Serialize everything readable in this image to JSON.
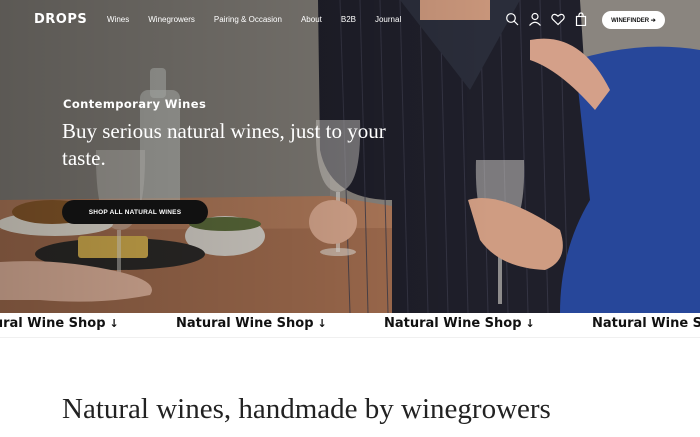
{
  "brand": {
    "logo": "DROPS"
  },
  "nav": {
    "links": [
      "Wines",
      "Winegrowers",
      "Pairing & Occasion",
      "About",
      "B2B",
      "Journal"
    ],
    "icons": [
      "search-icon",
      "account-icon",
      "wishlist-heart-icon",
      "cart-bag-icon"
    ],
    "winefinder_label": "WINEFINDER ➔"
  },
  "hero": {
    "eyebrow": "Contemporary Wines",
    "headline": "Buy serious natural wines, just to your taste.",
    "cta_label": "SHOP ALL NATURAL WINES"
  },
  "marquee": {
    "items": [
      "Natural Wine Shop",
      "Natural Wine Shop",
      "Natural Wine Shop",
      "Natural Wine Shop"
    ],
    "arrow": "↓"
  },
  "section": {
    "title": "Natural wines, handmade by winegrowers"
  },
  "colors": {
    "text_dark": "#111111",
    "hero_overlay_text": "#ffffff",
    "button_dark": "#111111",
    "marquee_bg": "#ffffff"
  }
}
